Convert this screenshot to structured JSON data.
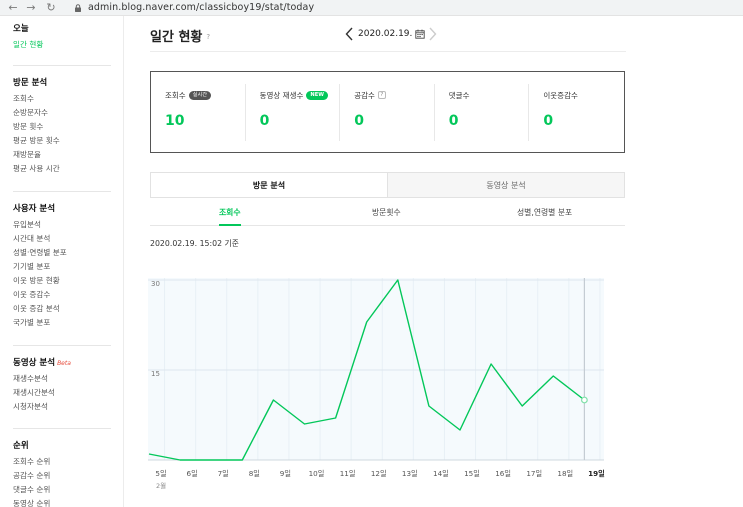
{
  "browser": {
    "url": "admin.blog.naver.com/classicboy19/stat/today"
  },
  "sidebar": {
    "sections": [
      {
        "title": "오늘",
        "items": [
          {
            "label": "일간 현황",
            "active": true
          }
        ]
      },
      {
        "title": "방문 분석",
        "items": [
          {
            "label": "조회수"
          },
          {
            "label": "순방문자수"
          },
          {
            "label": "방문 횟수"
          },
          {
            "label": "평균 방문 횟수"
          },
          {
            "label": "재방문율"
          },
          {
            "label": "평균 사용 시간"
          }
        ]
      },
      {
        "title": "사용자 분석",
        "items": [
          {
            "label": "유입분석"
          },
          {
            "label": "시간대 분석"
          },
          {
            "label": "성별·연령별 분포"
          },
          {
            "label": "기기별 분포"
          },
          {
            "label": "이웃 방문 현황"
          },
          {
            "label": "이웃 증감수"
          },
          {
            "label": "이웃 증감 분석"
          },
          {
            "label": "국가별 분포"
          }
        ]
      },
      {
        "title": "동영상 분석",
        "beta": "Beta",
        "items": [
          {
            "label": "재생수분석"
          },
          {
            "label": "재생시간분석"
          },
          {
            "label": "시청자분석"
          }
        ]
      },
      {
        "title": "순위",
        "items": [
          {
            "label": "조회수 순위"
          },
          {
            "label": "공감수 순위"
          },
          {
            "label": "댓글수 순위"
          },
          {
            "label": "동영상 순위"
          }
        ]
      }
    ]
  },
  "header": {
    "title": "일간 현황",
    "help": "?",
    "date": "2020.02.19."
  },
  "stats": [
    {
      "label": "조회수",
      "badge": "실시간",
      "value": "0"
    },
    {
      "label": "동영상 재생수",
      "badge": "NEW",
      "value": "0"
    },
    {
      "label": "공감수",
      "help": "?",
      "value": "0"
    },
    {
      "label": "댓글수",
      "value": "0"
    },
    {
      "label": "이웃증감수",
      "value": "0"
    }
  ],
  "stat_first_value": "10",
  "tabs": [
    {
      "label": "방문 분석",
      "active": true
    },
    {
      "label": "동영상 분석",
      "active": false
    }
  ],
  "subtabs": [
    {
      "label": "조회수",
      "active": true
    },
    {
      "label": "방문횟수",
      "active": false
    },
    {
      "label": "성별,연령별 분포",
      "active": false
    }
  ],
  "timestamp": "2020.02.19. 15:02 기준",
  "colors": {
    "accent": "#03c75a",
    "chart_bg": "#f5fafd",
    "grid": "#dde6ee"
  },
  "chart_data": {
    "type": "line",
    "x": [
      "5일",
      "6일",
      "7일",
      "8일",
      "9일",
      "10일",
      "11일",
      "12일",
      "13일",
      "14일",
      "15일",
      "16일",
      "17일",
      "18일",
      "19일"
    ],
    "values": [
      1,
      0,
      0,
      0,
      10,
      6,
      7,
      23,
      30,
      9,
      5,
      16,
      9,
      14,
      10
    ],
    "x_sub_label": "2월",
    "yticks": [
      15,
      30
    ],
    "ylim": [
      0,
      30
    ],
    "highlight_last": true
  }
}
